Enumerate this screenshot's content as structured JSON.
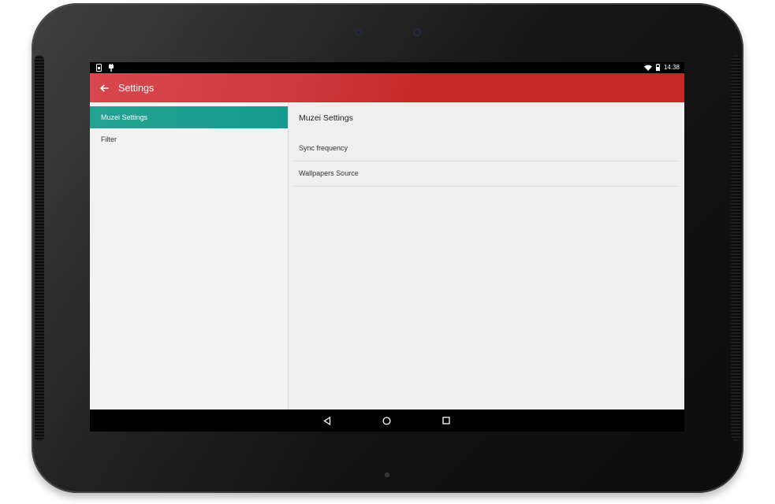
{
  "status_bar": {
    "time": "14:38",
    "left_icons": [
      "sim-card-icon",
      "usb-plug-icon"
    ],
    "right_icons": [
      "wifi-icon",
      "battery-icon"
    ]
  },
  "toolbar": {
    "title": "Settings",
    "color": "#c62828"
  },
  "headers": {
    "items": [
      {
        "label": "Muzei Settings",
        "active": true
      },
      {
        "label": "Filter",
        "active": false
      }
    ],
    "accent_color": "#169c8e"
  },
  "detail": {
    "title": "Muzei Settings",
    "preferences": [
      {
        "label": "Sync frequency"
      },
      {
        "label": "Wallpapers Source"
      }
    ]
  },
  "nav_bar": {
    "buttons": [
      "back-icon",
      "home-icon",
      "recents-icon"
    ]
  }
}
